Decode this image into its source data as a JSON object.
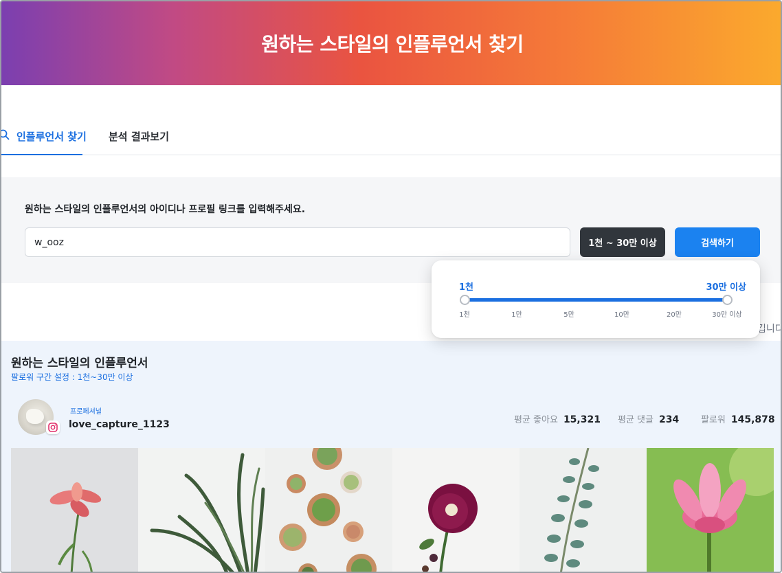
{
  "header": {
    "title": "원하는 스타일의 인플루언서 찾기"
  },
  "tabs": [
    {
      "label": "인플루언서 찾기",
      "active": true,
      "icon": "search-icon"
    },
    {
      "label": "분석 결과보기",
      "active": false
    }
  ],
  "search": {
    "prompt": "원하는 스타일의 인플루언서의 아이디나 프로필 링크를 입력해주세요.",
    "value": "w_ooz",
    "range_button": "1천 ~ 30만 이상",
    "submit_button": "검색하기",
    "hidden_text_fragment": "깁니다"
  },
  "range_popover": {
    "min_label": "1천",
    "max_label": "30만 이상",
    "ticks": [
      "1천",
      "1만",
      "5만",
      "10만",
      "20만",
      "30만 이상"
    ],
    "selected_min": "1천",
    "selected_max": "30만 이상"
  },
  "results": {
    "title": "원하는 스타일의 인플루언서",
    "subtitle": "팔로워 구간 설정 : 1천~30만 이상",
    "influencer": {
      "tier": "프로페셔널",
      "handle": "love_capture_1123",
      "platform_icon": "instagram-icon",
      "stats": [
        {
          "label": "평균 좋아요",
          "value": "15,321"
        },
        {
          "label": "평균 댓글",
          "value": "234"
        },
        {
          "label": "팔로워",
          "value": "145,878"
        }
      ]
    },
    "photos": [
      "pink-lily-photo",
      "grass-plant-photo",
      "succulents-photo",
      "hollyhock-flower-photo",
      "eucalyptus-photo",
      "lotus-photo"
    ]
  },
  "colors": {
    "accent": "#1b6fe0",
    "primary_button": "#1b82f0",
    "dark_button": "#31363c",
    "header_gradient": [
      "#7b3fb0",
      "#ea5440",
      "#fbaa2d"
    ]
  }
}
